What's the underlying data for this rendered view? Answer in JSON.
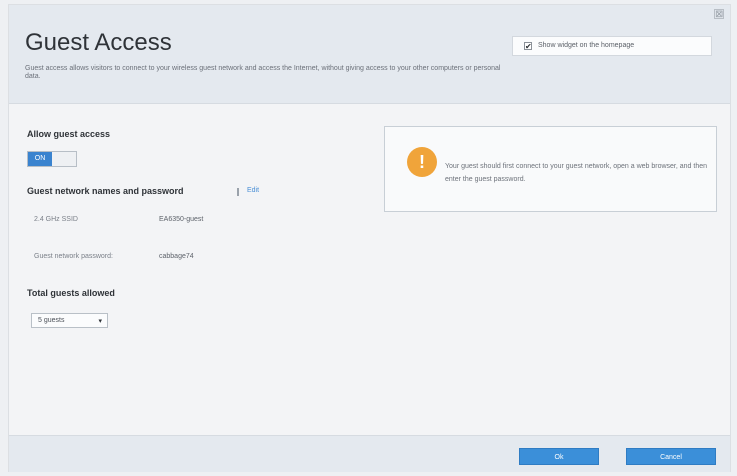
{
  "page": {
    "title": "Guest Access",
    "description": "Guest access allows visitors to connect to your wireless guest network and access the Internet, without giving access to your other computers or personal data.",
    "close_glyph": "⊠"
  },
  "widget": {
    "label": "Show widget on the homepage",
    "checked": true,
    "check_glyph": "✔"
  },
  "allow_guest": {
    "label": "Allow guest access",
    "toggle_label": "ON",
    "enabled": true
  },
  "network": {
    "heading": "Guest network names and password",
    "edit_label": "Edit",
    "ssid_label": "2.4 GHz SSID",
    "ssid_value": "EA6350-guest",
    "password_label": "Guest network password:",
    "password_value": "cabbage74"
  },
  "total_guests": {
    "label": "Total guests allowed",
    "selected": "5 guests",
    "arrow": "▾"
  },
  "notice": {
    "icon": "warning-icon",
    "icon_glyph": "!",
    "text": "Your guest should first connect to your guest network, open a web browser, and then enter the guest password."
  },
  "footer": {
    "ok_label": "Ok",
    "cancel_label": "Cancel"
  },
  "colors": {
    "accent": "#3a83cf",
    "warning": "#f0a43a"
  }
}
